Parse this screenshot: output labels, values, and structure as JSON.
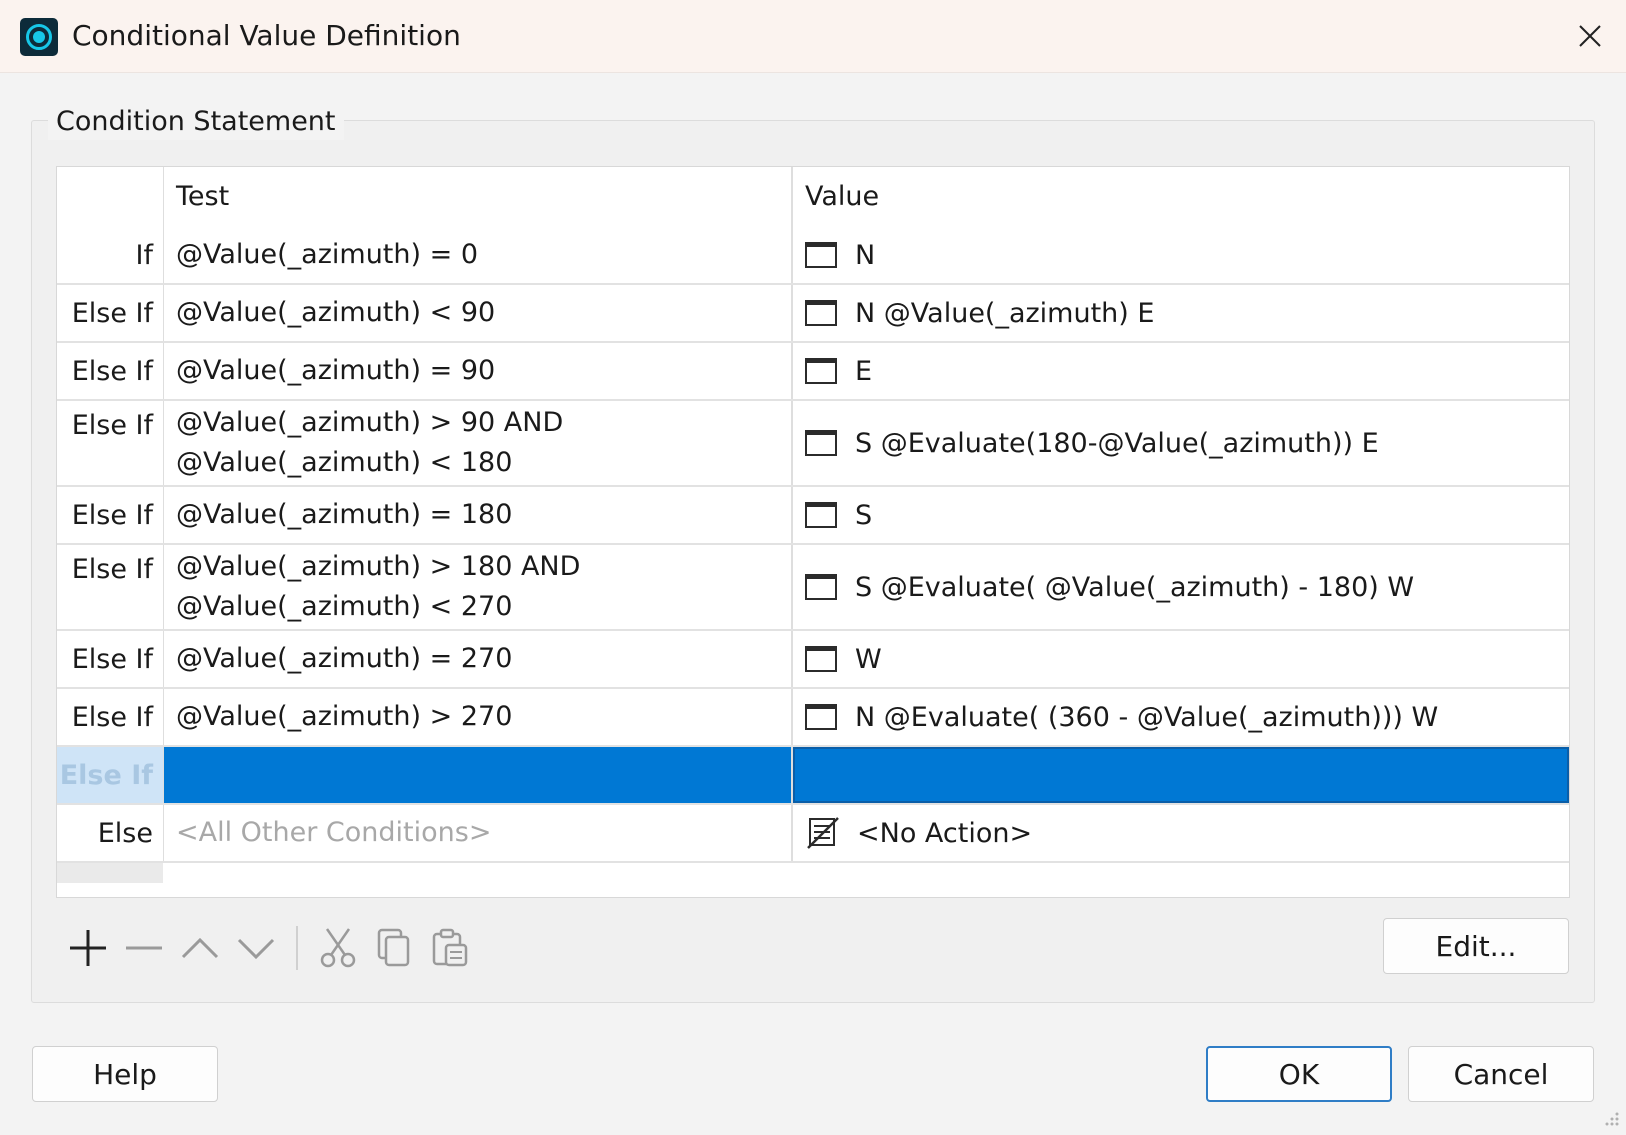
{
  "window": {
    "title": "Conditional Value Definition",
    "close_icon": "close-icon",
    "app_icon": "target-app-icon"
  },
  "group": {
    "label": "Condition Statement"
  },
  "grid": {
    "columns": {
      "test": "Test",
      "value": "Value"
    },
    "rows": [
      {
        "keyword": "If",
        "test": [
          "@Value(_azimuth) = 0"
        ],
        "value": "N",
        "icon": "window-icon"
      },
      {
        "keyword": "Else If",
        "test": [
          "@Value(_azimuth) < 90"
        ],
        "value": "N @Value(_azimuth) E",
        "icon": "window-icon"
      },
      {
        "keyword": "Else If",
        "test": [
          "@Value(_azimuth) = 90"
        ],
        "value": "E",
        "icon": "window-icon"
      },
      {
        "keyword": "Else If",
        "test": [
          "@Value(_azimuth) > 90 AND",
          "@Value(_azimuth) < 180"
        ],
        "value": "S @Evaluate(180-@Value(_azimuth)) E",
        "icon": "window-icon"
      },
      {
        "keyword": "Else If",
        "test": [
          "@Value(_azimuth) = 180"
        ],
        "value": "S",
        "icon": "window-icon"
      },
      {
        "keyword": "Else If",
        "test": [
          "@Value(_azimuth) > 180 AND",
          "@Value(_azimuth) < 270"
        ],
        "value": "S @Evaluate( @Value(_azimuth) - 180) W",
        "icon": "window-icon"
      },
      {
        "keyword": "Else If",
        "test": [
          "@Value(_azimuth) = 270"
        ],
        "value": "W",
        "icon": "window-icon"
      },
      {
        "keyword": "Else If",
        "test": [
          "@Value(_azimuth) > 270"
        ],
        "value": "N @Evaluate( (360 - @Value(_azimuth))) W",
        "icon": "window-icon"
      }
    ],
    "new_row": {
      "keyword": "Else If",
      "selected": true
    },
    "else_row": {
      "keyword": "Else",
      "test_placeholder": "<All Other Conditions>",
      "value": "<No Action>",
      "icon": "no-action-icon"
    },
    "selection_color": "#0078d4"
  },
  "toolbar": {
    "items": [
      "add-icon",
      "remove-icon",
      "move-up-icon",
      "move-down-icon",
      "cut-icon",
      "copy-icon",
      "paste-icon"
    ],
    "edit_label": "Edit..."
  },
  "buttons": {
    "help": "Help",
    "ok": "OK",
    "cancel": "Cancel"
  }
}
